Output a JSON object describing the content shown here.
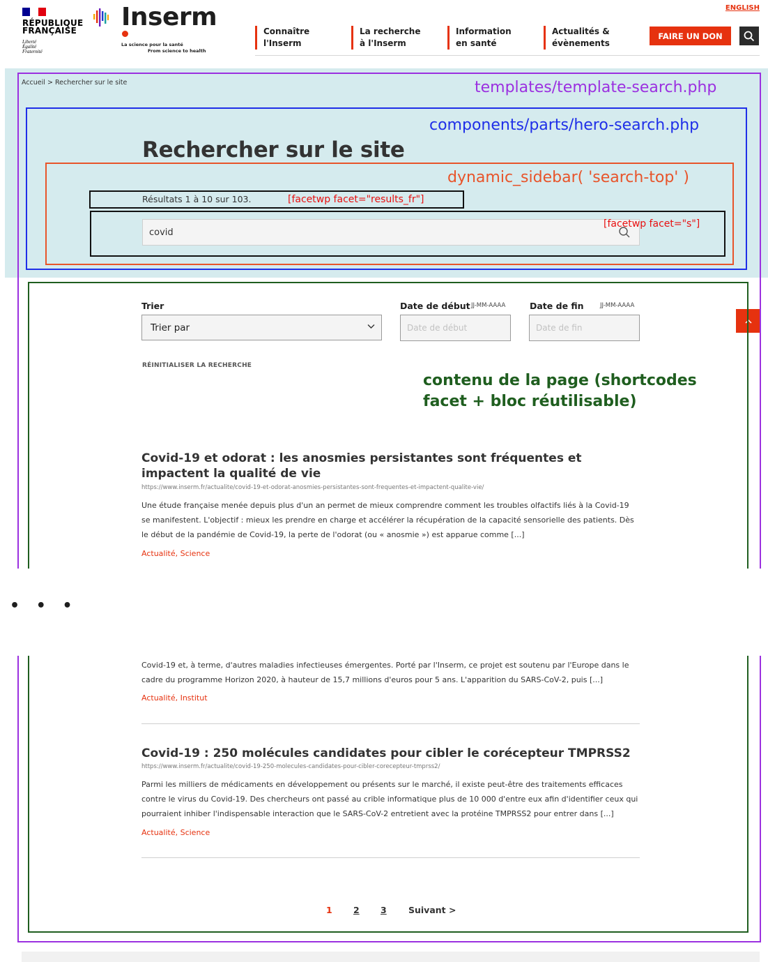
{
  "header": {
    "republique": {
      "line1": "RÉPUBLIQUE",
      "line2": "FRANÇAISE",
      "motto": [
        "Liberté",
        "Égalité",
        "Fraternité"
      ]
    },
    "logo": {
      "name": "Inserm",
      "tagline_fr": "La science pour la santé",
      "tagline_en": "From science to health"
    },
    "language_link": "ENGLISH",
    "nav": [
      {
        "label": "Connaître\nl'Inserm"
      },
      {
        "label": "La recherche\nà l'Inserm"
      },
      {
        "label": "Information\nen santé"
      },
      {
        "label": "Actualités &\névènements"
      }
    ],
    "donate_label": "FAIRE UN DON",
    "search_icon": "search-icon"
  },
  "breadcrumb": {
    "home": "Accueil",
    "separator": ">",
    "current": "Rechercher sur le site"
  },
  "hero": {
    "title": "Rechercher sur le site",
    "results_count": "Résultats 1 à 10 sur 103.",
    "search_value": "covid"
  },
  "annotations": {
    "template": "templates/template-search.php",
    "hero": "components/parts/hero-search.php",
    "sidebar": "dynamic_sidebar( 'search-top' )",
    "results_facet": "[facetwp facet=\"results_fr\"]",
    "search_facet": "[facetwp facet=\"s\"]",
    "content_line1": "contenu de la page (shortcodes",
    "content_line2": "facet + bloc réutilisable)"
  },
  "filters": {
    "sort_label": "Trier",
    "sort_value": "Trier par",
    "start_label": "Date de début",
    "start_hint": "JJ-MM-AAAA",
    "start_placeholder": "Date de début",
    "end_label": "Date de fin",
    "end_hint": "JJ-MM-AAAA",
    "end_placeholder": "Date de fin",
    "reset_label": "RÉINITIALISER LA RECHERCHE"
  },
  "results": [
    {
      "title": "Covid-19 et odorat : les anosmies persistantes sont fréquentes et impactent la qualité de vie",
      "url": "https://www.inserm.fr/actualite/covid-19-et-odorat-anosmies-persistantes-sont-frequentes-et-impactent-qualite-vie/",
      "description": "Une étude française menée depuis plus d'un an permet de mieux comprendre comment les troubles olfactifs liés à la Covid-19 se manifestent. L'objectif : mieux les prendre en charge et accélérer la récupération de la capacité sensorielle des patients. Dès le début de la pandémie de Covid-19, la perte de l'odorat (ou « anosmie ») est apparue comme [...]",
      "categories": "Actualité, Science"
    },
    {
      "description_partial": "Covid-19 et, à terme, d'autres maladies infectieuses émergentes. Porté par l'Inserm, ce projet est soutenu par l'Europe dans le cadre du programme Horizon 2020, à hauteur de 15,7 millions d'euros pour 5 ans. L'apparition du SARS-CoV-2, puis [...]",
      "categories": "Actualité, Institut"
    },
    {
      "title": "Covid-19 : 250 molécules candidates pour cibler le corécepteur TMPRSS2",
      "url": "https://www.inserm.fr/actualite/covid-19-250-molecules-candidates-pour-cibler-corecepteur-tmprss2/",
      "description": "Parmi les milliers de médicaments en développement ou présents sur le marché, il existe peut-être des traitements efficaces contre le virus du Covid-19. Des chercheurs ont passé au crible informatique plus de 10 000 d'entre eux afin d'identifier ceux qui pourraient inhiber l'indispensable interaction que le SARS-CoV-2 entretient avec la protéine TMPRSS2 pour entrer dans [...]",
      "categories": "Actualité, Science"
    }
  ],
  "truncation_marker": "• • •",
  "pagination": {
    "current": "1",
    "pages": [
      "2",
      "3"
    ],
    "next": "Suivant >"
  },
  "colors": {
    "brand_red": "#e6320f",
    "hero_bg": "#d5ebee",
    "annotation_purple": "#9b30e0",
    "annotation_blue": "#1f2fe8",
    "annotation_orange": "#e8542a",
    "annotation_green": "#1f5e1f"
  }
}
